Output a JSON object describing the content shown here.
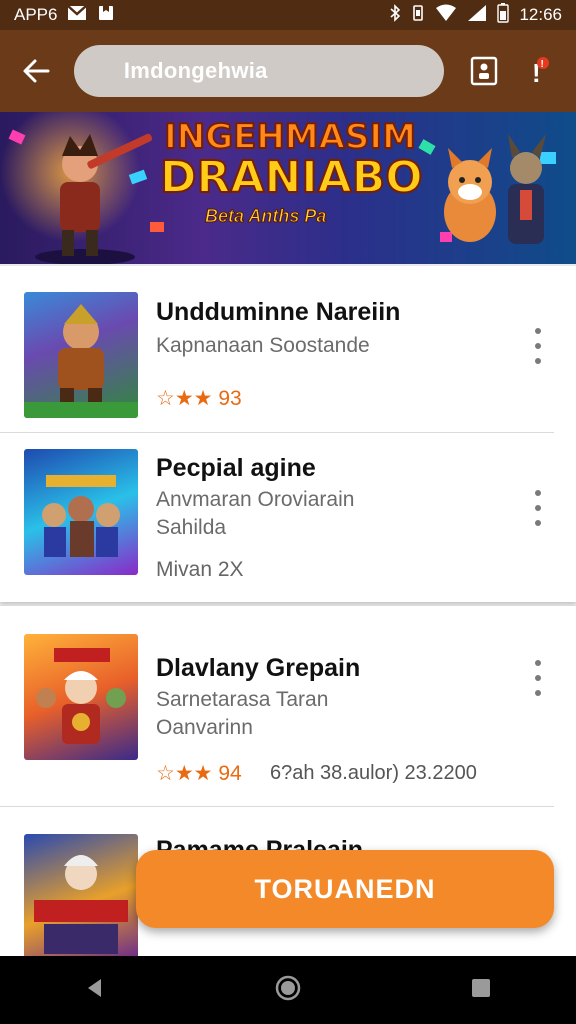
{
  "status_bar": {
    "left_text": "APP6",
    "time": "12:66",
    "left_icons": [
      "gmail-icon",
      "notification-icon"
    ],
    "right_icons": [
      "bluetooth-icon",
      "vibrate-icon",
      "wifi-icon",
      "signal-icon",
      "battery-icon"
    ]
  },
  "app_bar": {
    "back_icon": "back-arrow-icon",
    "search_text": "Imdongehwia",
    "right_icons": [
      "contact-card-icon",
      "alert-icon"
    ]
  },
  "banner": {
    "title_line1": "INGEHMASIM",
    "title_line2": "DRANIABO",
    "subtitle": "Beta Anths Pa"
  },
  "items": [
    {
      "title": "Undduminne Nareiin",
      "subtitle": "Kapnanaan Soostande",
      "rating": "☆★★ 93"
    },
    {
      "title": "Pecpial agine",
      "subtitle": "Anvmaran Oroviarain",
      "subtitle2": "Sahilda",
      "meta": "Mivan 2X"
    },
    {
      "title": "Dlavlany Grepain",
      "subtitle": "Sarnetarasa Taran",
      "subtitle2": "Oanvarinn",
      "rating": "☆★★ 94",
      "extra": "6?ah 38.aulor) 23.2200"
    },
    {
      "title": "Pamame Praleain"
    }
  ],
  "fab_label": "TORUANEDN",
  "colors": {
    "status_bar": "#4f2c12",
    "app_bar": "#6b3a18",
    "accent": "#f4892a",
    "rating": "#e86a12"
  }
}
